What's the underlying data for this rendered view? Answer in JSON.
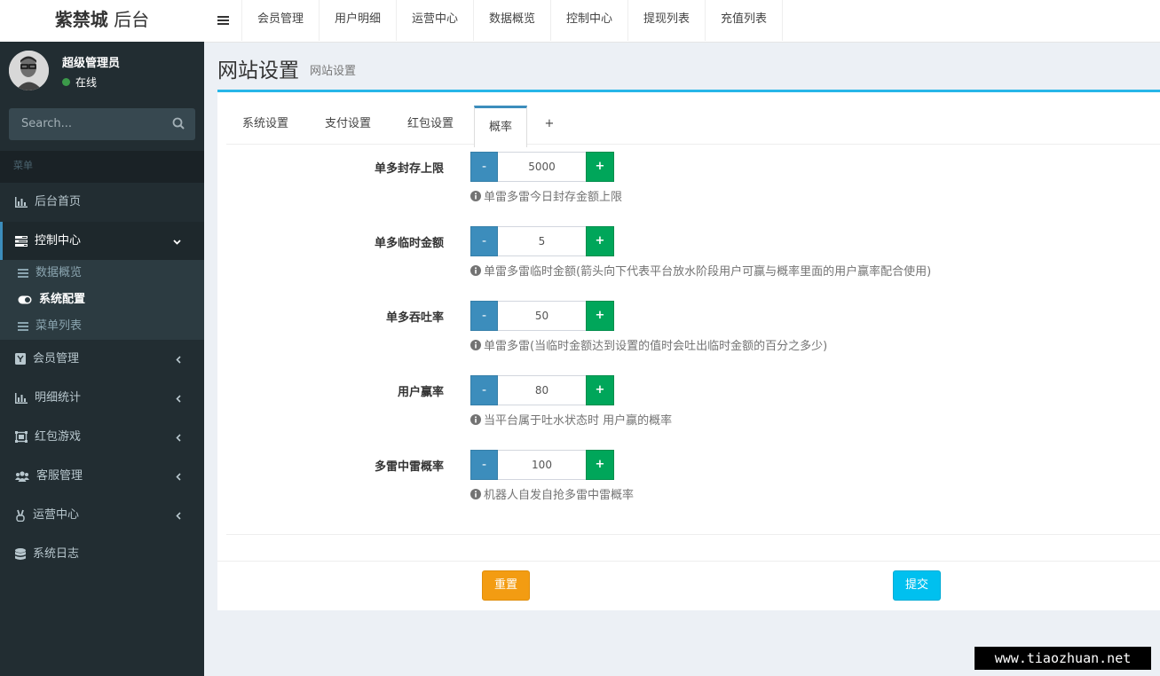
{
  "brand": {
    "name_bold": "紫禁城",
    "name_rest": " 后台"
  },
  "user": {
    "name": "超级管理员",
    "status": "在线"
  },
  "search": {
    "placeholder": "Search..."
  },
  "menu_header": "菜单",
  "sidebar": {
    "items": [
      {
        "label": "后台首页",
        "icon": "bar-chart-icon"
      },
      {
        "label": "控制中心",
        "icon": "tasks-icon"
      },
      {
        "label": "会员管理",
        "icon": "id-card-icon"
      },
      {
        "label": "明细统计",
        "icon": "bar-chart-icon"
      },
      {
        "label": "红包游戏",
        "icon": "object-group-icon"
      },
      {
        "label": "客服管理",
        "icon": "users-icon"
      },
      {
        "label": "运营中心",
        "icon": "hand-peace-icon"
      },
      {
        "label": "系统日志",
        "icon": "database-icon"
      }
    ],
    "submenu": [
      {
        "label": "数据概览",
        "icon": "list-icon"
      },
      {
        "label": "系统配置",
        "icon": "toggle-on-icon"
      },
      {
        "label": "菜单列表",
        "icon": "list-icon"
      }
    ]
  },
  "topnav": [
    "会员管理",
    "用户明细",
    "运营中心",
    "数据概览",
    "控制中心",
    "提现列表",
    "充值列表"
  ],
  "page": {
    "title": "网站设置",
    "subtitle": "网站设置"
  },
  "tabs": [
    "系统设置",
    "支付设置",
    "红包设置",
    "概率",
    "+"
  ],
  "fields": [
    {
      "label": "单多封存上限",
      "value": "5000",
      "help": "单雷多雷今日封存金额上限"
    },
    {
      "label": "单多临时金额",
      "value": "5",
      "help": "单雷多雷临时金额(箭头向下代表平台放水阶段用户可赢与概率里面的用户赢率配合使用)"
    },
    {
      "label": "单多吞吐率",
      "value": "50",
      "help": "单雷多雷(当临时金额达到设置的值时会吐出临时金额的百分之多少)"
    },
    {
      "label": "用户赢率",
      "value": "80",
      "help": "当平台属于吐水状态时 用户赢的概率"
    },
    {
      "label": "多雷中雷概率",
      "value": "100",
      "help": "机器人自发自抢多雷中雷概率"
    }
  ],
  "stepper": {
    "minus": "-",
    "plus": "+"
  },
  "buttons": {
    "reset": "重置",
    "submit": "提交"
  },
  "watermark": "www.tiaozhuan.net",
  "colors": {
    "sidebar": "#222d32",
    "accent": "#3c8dbc",
    "success": "#00a65a",
    "warning": "#f39c12",
    "info": "#00c0ef"
  }
}
